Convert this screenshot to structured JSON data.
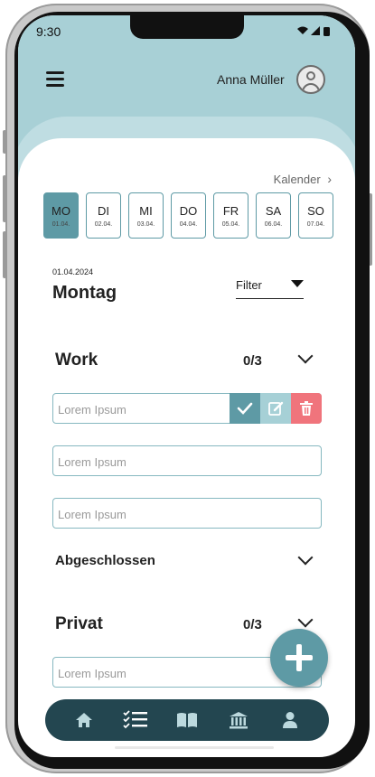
{
  "status_bar": {
    "time": "9:30"
  },
  "header": {
    "user_name": "Anna Müller"
  },
  "calendar": {
    "link_label": "Kalender",
    "days": [
      {
        "abbr": "MO",
        "date": "01.04."
      },
      {
        "abbr": "DI",
        "date": "02.04."
      },
      {
        "abbr": "MI",
        "date": "03.04."
      },
      {
        "abbr": "DO",
        "date": "04.04."
      },
      {
        "abbr": "FR",
        "date": "05.04."
      },
      {
        "abbr": "SA",
        "date": "06.04."
      },
      {
        "abbr": "SO",
        "date": "07.04."
      }
    ],
    "selected_index": 0
  },
  "day": {
    "date": "01.04.2024",
    "title": "Montag"
  },
  "filter": {
    "label": "Filter"
  },
  "work": {
    "title": "Work",
    "count": "0/3",
    "tasks": [
      "Lorem Ipsum",
      "Lorem Ipsum",
      "Lorem Ipsum"
    ],
    "completed_label": "Abgeschlossen"
  },
  "privat": {
    "title": "Privat",
    "count": "0/3",
    "tasks": [
      "Lorem Ipsum"
    ]
  },
  "fab": {
    "icon": "plus-icon"
  },
  "bottom_nav": {
    "items": [
      "home-icon",
      "task-list-icon",
      "book-icon",
      "bank-icon",
      "person-icon"
    ],
    "active_index": 1
  },
  "colors": {
    "accent": "#5e9aa5",
    "header": "#a8d0d6",
    "nav": "#234650",
    "delete": "#f0747c"
  }
}
